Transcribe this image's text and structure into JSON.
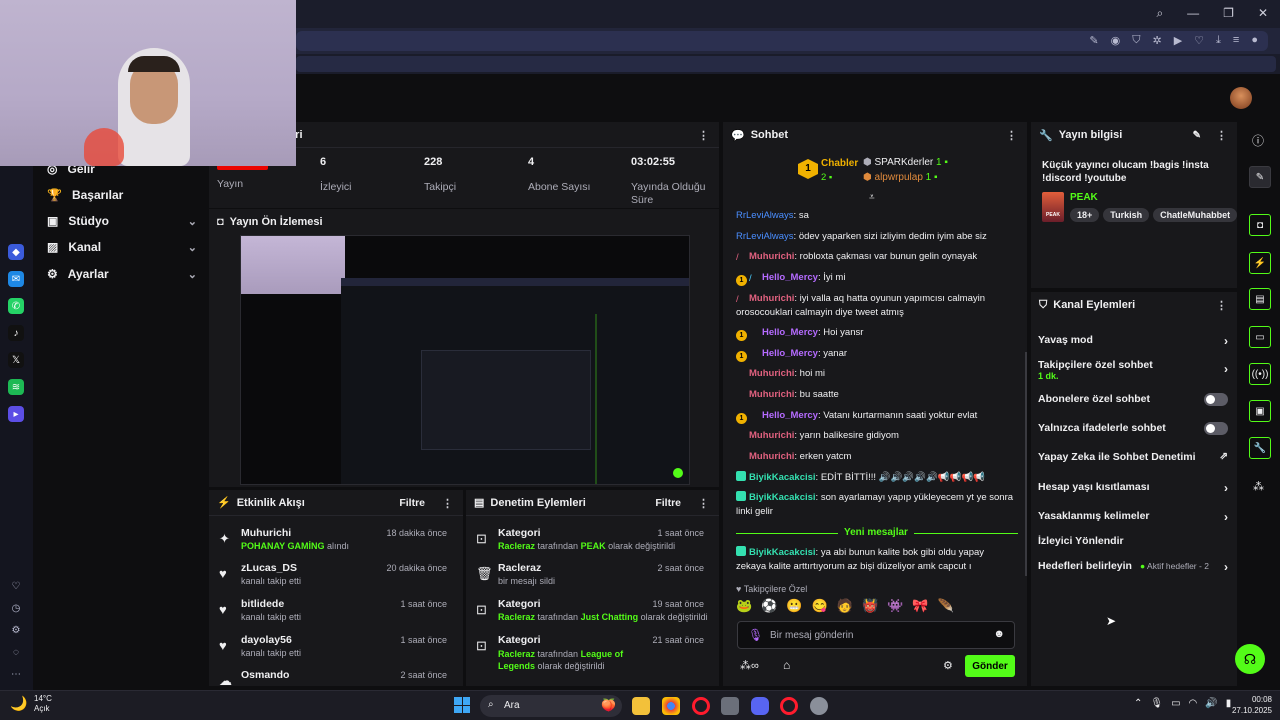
{
  "sidebar": {
    "items": [
      {
        "label": "Gelir"
      },
      {
        "label": "Başarılar"
      },
      {
        "label": "Stüdyo"
      },
      {
        "label": "Kanal"
      },
      {
        "label": "Ayarlar"
      }
    ]
  },
  "stats": {
    "title_partial": "leri",
    "items": [
      {
        "value": "YAYINDA",
        "label": "Yayın"
      },
      {
        "value": "6",
        "label": "İzleyici"
      },
      {
        "value": "228",
        "label": "Takipçi"
      },
      {
        "value": "4",
        "label": "Abone Sayısı"
      },
      {
        "value": "03:02:55",
        "label": "Yayında Olduğu Süre"
      }
    ]
  },
  "preview": {
    "title": "Yayın Ön İzlemesi"
  },
  "activity": {
    "title": "Etkinlik Akışı",
    "filter": "Filtre",
    "items": [
      {
        "name": "Muhurichi",
        "highlight": "POHANAY GAMİNG",
        "rest": " alındı",
        "time": "18 dakika önce"
      },
      {
        "name": "zLucas_DS",
        "highlight": "",
        "rest": "kanalı takip etti",
        "time": "20 dakika önce"
      },
      {
        "name": "bitlidede",
        "highlight": "",
        "rest": "kanalı takip etti",
        "time": "1 saat önce"
      },
      {
        "name": "dayolay56",
        "highlight": "",
        "rest": "kanalı takip etti",
        "time": "1 saat önce"
      },
      {
        "name": "Osmando",
        "highlight": "",
        "rest": "",
        "time": "2 saat önce"
      }
    ]
  },
  "moderation": {
    "title": "Denetim Eylemleri",
    "filter": "Filtre",
    "items": [
      {
        "title": "Kategori",
        "actor": "Racleraz",
        "mid": " tarafından ",
        "target": "PEAK",
        "rest": " olarak değiştirildi",
        "time": "1 saat önce"
      },
      {
        "title": "Racleraz",
        "actor": "",
        "mid": "",
        "target": "",
        "rest": "bir mesajı sildi",
        "time": "2 saat önce"
      },
      {
        "title": "Kategori",
        "actor": "Racleraz",
        "mid": " tarafından ",
        "target": "Just Chatting",
        "rest": " olarak değiştirildi",
        "time": "19 saat önce"
      },
      {
        "title": "Kategori",
        "actor": "Racleraz",
        "mid": " tarafından ",
        "target": "League of Legends",
        "rest": " olarak değiştirildi",
        "time": "21 saat önce"
      }
    ]
  },
  "chat": {
    "title": "Sohbet",
    "leaderboard": [
      {
        "name": "Chabler",
        "count": "2"
      },
      {
        "name": "SPARKderler",
        "count": "1"
      },
      {
        "name": "alpwrpulap",
        "count": "1"
      }
    ],
    "messages": [
      {
        "user": "RrLeviAlways",
        "text": "sa"
      },
      {
        "user": "RrLeviAlways",
        "text": "ödev yaparken sizi izliyim dedim iyim abe siz"
      },
      {
        "user": "Muhurichi",
        "text": "robloxta çakması var bunun gelin oynayak"
      },
      {
        "user": "Hello_Mercy",
        "text": "İyi mi"
      },
      {
        "user": "Muhurichi",
        "text": "iyi valla aq hatta oyunun yapımcısı calmayin orosocouklari calmayin diye tweet atmış"
      },
      {
        "user": "Hello_Mercy",
        "text": "Hoi yansr"
      },
      {
        "user": "Hello_Mercy",
        "text": "yanar"
      },
      {
        "user": "Muhurichi",
        "text": "hoi mi"
      },
      {
        "user": "Muhurichi",
        "text": "bu saatte"
      },
      {
        "user": "Hello_Mercy",
        "text": "Vatanı kurtarmanın saati yoktur evlat"
      },
      {
        "user": "Muhurichi",
        "text": "yarın balikesire gidiyom"
      },
      {
        "user": "Muhurichi",
        "text": "erken yatcm"
      },
      {
        "user": "BiyikKacakcisi",
        "text": "EDİT BİTTİ!!! 🔊🔊🔊🔊🔊📢📢📢📢"
      },
      {
        "user": "BiyikKacakcisi",
        "text": "son ayarlamayı yapıp yükleyecem yt ye sonra linki gelir"
      },
      {
        "user": "BiyikKacakcisi",
        "text": "ya abi bunun kalite bok gibi oldu yapay zekaya kalite arttırtıyorum az bişi düzeliyor amk capcut ı"
      }
    ],
    "new_messages": "Yeni mesajlar",
    "followers_only": "Takipçilere Özel",
    "input_placeholder": "Bir mesaj gönderin",
    "send": "Gönder"
  },
  "stream_info": {
    "title": "Yayın bilgisi",
    "stream_title": "Küçük yayıncı olucam !bagis !insta !discord !youtube",
    "category": "PEAK",
    "tags": [
      "18+",
      "Turkish",
      "ChatleMuhabbet"
    ]
  },
  "channel_actions": {
    "title": "Kanal Eylemleri",
    "items": [
      {
        "label": "Yavaş mod",
        "sub": ""
      },
      {
        "label": "Takipçilere özel sohbet",
        "sub": "1 dk."
      },
      {
        "label": "Abonelere özel sohbet",
        "sub": ""
      },
      {
        "label": "Yalnızca ifadelerle sohbet",
        "sub": ""
      },
      {
        "label": "Yapay Zeka ile Sohbet Denetimi",
        "sub": ""
      },
      {
        "label": "Hesap yaşı kısıtlaması",
        "sub": ""
      },
      {
        "label": "Yasaklanmış kelimeler",
        "sub": ""
      },
      {
        "label": "İzleyici Yönlendir",
        "sub": ""
      },
      {
        "label": "Hedefleri belirleyin",
        "sub": ""
      }
    ],
    "goals_status": "Aktif hedefler - 2"
  },
  "taskbar": {
    "weather_temp": "14°C",
    "weather_desc": "Açık",
    "search": "Ara",
    "time": "00:08",
    "date": "27.10.2025"
  },
  "colors": {
    "accent": "#53fc18",
    "panel": "#18181b",
    "bg": "#0e0e10"
  }
}
